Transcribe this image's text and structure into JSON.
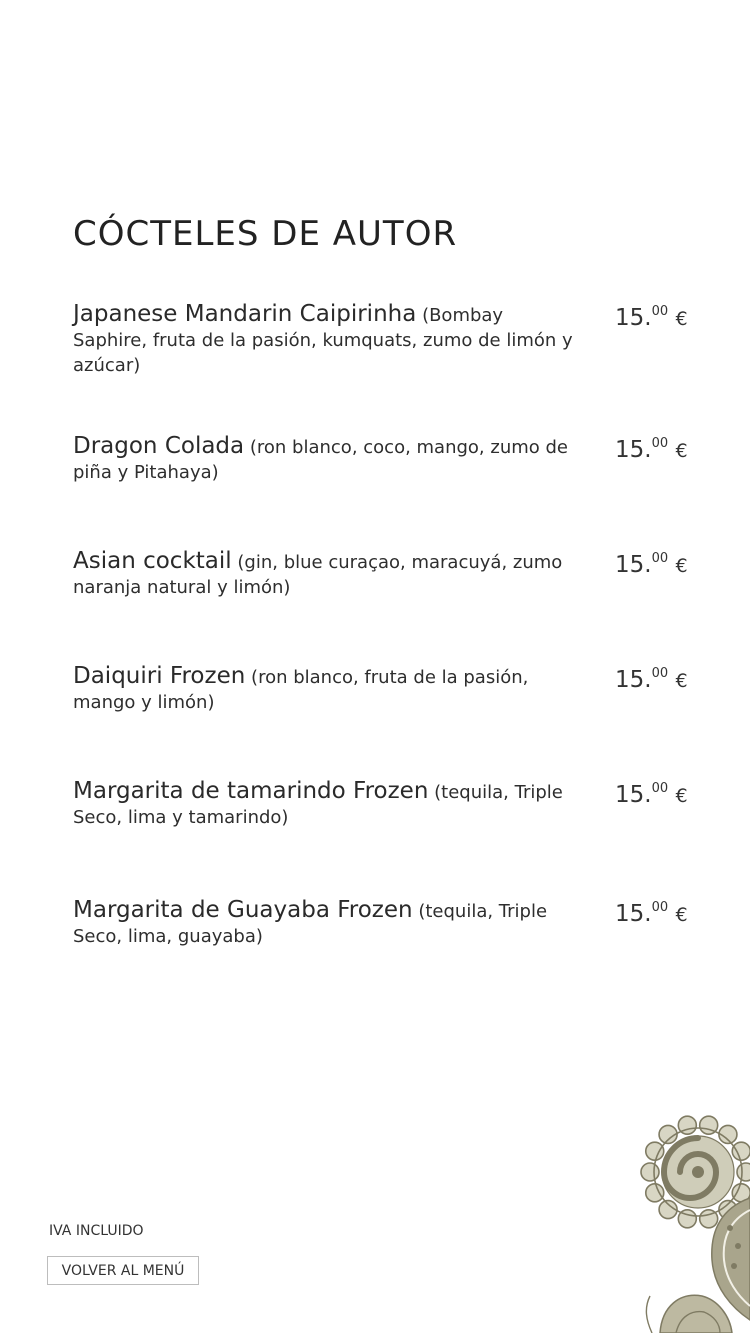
{
  "page": {
    "title": "CÓCTELES DE AUTOR"
  },
  "items": [
    {
      "name": "Japanese Mandarin Caipirinha",
      "desc": "(Bombay Saphire, fruta de la pasión, kumquats, zumo de limón y azúcar)",
      "price_int": "15.",
      "price_cents": "00",
      "currency": "€"
    },
    {
      "name": "Dragon Colada",
      "desc": "(ron blanco, coco, mango, zumo de piña y Pitahaya)",
      "price_int": "15.",
      "price_cents": "00",
      "currency": "€"
    },
    {
      "name": "Asian cocktail",
      "desc": "(gin, blue curaçao, maracuyá, zumo naranja natural y limón)",
      "price_int": "15.",
      "price_cents": "00",
      "currency": "€"
    },
    {
      "name": "Daiquiri Frozen",
      "desc": "(ron blanco, fruta de la pasión, mango y limón)",
      "price_int": "15.",
      "price_cents": "00",
      "currency": "€"
    },
    {
      "name": "Margarita de tamarindo Frozen",
      "desc": "(tequila, Triple Seco, lima y tamarindo)",
      "price_int": "15.",
      "price_cents": "00",
      "currency": "€"
    },
    {
      "name": "Margarita de Guayaba Frozen",
      "desc": "(tequila, Triple Seco, lima, guayaba)",
      "price_int": "15.",
      "price_cents": "00",
      "currency": "€"
    }
  ],
  "footer": {
    "iva": "IVA INCLUIDO",
    "back_label": "VOLVER AL MENÚ"
  },
  "colors": {
    "ornament": "#a9a58c",
    "ornament_dark": "#7f7b63"
  },
  "icons": {
    "ornament": "paisley-ornament-icon"
  }
}
